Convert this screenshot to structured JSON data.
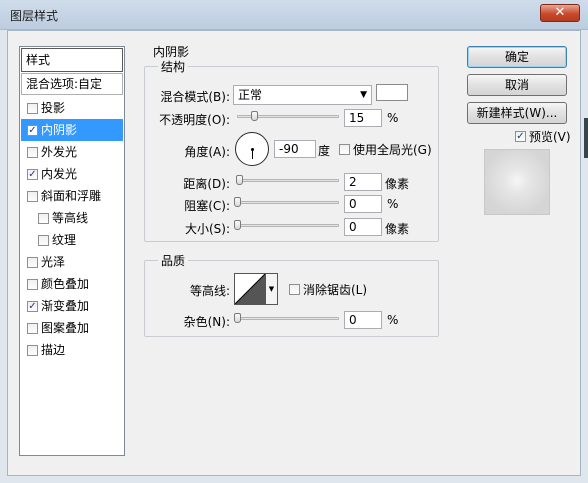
{
  "window": {
    "title": "图层样式",
    "close_glyph": "✕"
  },
  "styles_list": {
    "header": "样式",
    "blending_options": "混合选项:自定",
    "items": [
      {
        "label": "投影",
        "checked": false,
        "indent": false,
        "selected": false
      },
      {
        "label": "内阴影",
        "checked": true,
        "indent": false,
        "selected": true
      },
      {
        "label": "外发光",
        "checked": false,
        "indent": false,
        "selected": false
      },
      {
        "label": "内发光",
        "checked": true,
        "indent": false,
        "selected": false
      },
      {
        "label": "斜面和浮雕",
        "checked": false,
        "indent": false,
        "selected": false
      },
      {
        "label": "等高线",
        "checked": false,
        "indent": true,
        "selected": false
      },
      {
        "label": "纹理",
        "checked": false,
        "indent": true,
        "selected": false
      },
      {
        "label": "光泽",
        "checked": false,
        "indent": false,
        "selected": false
      },
      {
        "label": "颜色叠加",
        "checked": false,
        "indent": false,
        "selected": false
      },
      {
        "label": "渐变叠加",
        "checked": true,
        "indent": false,
        "selected": false
      },
      {
        "label": "图案叠加",
        "checked": false,
        "indent": false,
        "selected": false
      },
      {
        "label": "描边",
        "checked": false,
        "indent": false,
        "selected": false
      }
    ]
  },
  "inner_shadow": {
    "title": "内阴影",
    "structure": {
      "legend": "结构",
      "blend_mode_label": "混合模式(B):",
      "blend_mode_value": "正常",
      "blend_color": "#ffffff",
      "opacity_label": "不透明度(O):",
      "opacity_value": "15",
      "opacity_unit": "%",
      "angle_label": "角度(A):",
      "angle_value": "-90",
      "angle_unit": "度",
      "global_light_label": "使用全局光(G)",
      "global_light_checked": false,
      "distance_label": "距离(D):",
      "distance_value": "2",
      "distance_unit": "像素",
      "choke_label": "阻塞(C):",
      "choke_value": "0",
      "choke_unit": "%",
      "size_label": "大小(S):",
      "size_value": "0",
      "size_unit": "像素"
    },
    "quality": {
      "legend": "品质",
      "contour_label": "等高线:",
      "anti_alias_label": "消除锯齿(L)",
      "anti_alias_checked": false,
      "noise_label": "杂色(N):",
      "noise_value": "0",
      "noise_unit": "%"
    }
  },
  "actions": {
    "ok_label": "确定",
    "cancel_label": "取消",
    "new_style_label": "新建样式(W)...",
    "preview_label": "预览(V)",
    "preview_checked": true
  }
}
